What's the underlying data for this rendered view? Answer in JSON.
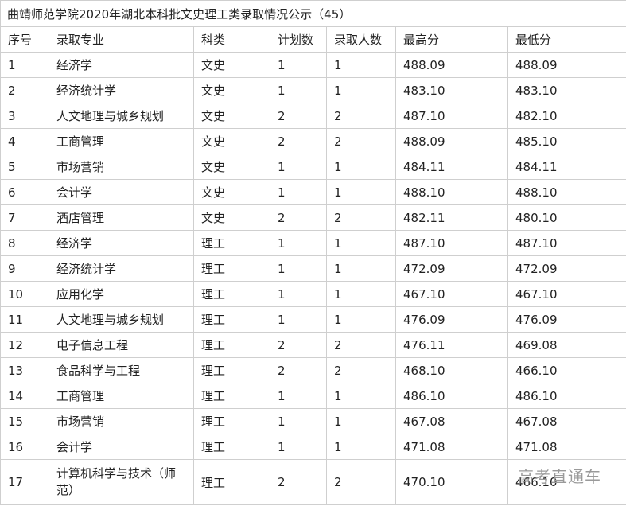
{
  "title": "曲靖师范学院2020年湖北本科批文史理工类录取情况公示（45）",
  "headers": [
    "序号",
    "录取专业",
    "科类",
    "计划数",
    "录取人数",
    "最高分",
    "最低分"
  ],
  "rows": [
    [
      "1",
      "经济学",
      "文史",
      "1",
      "1",
      "488.09",
      "488.09"
    ],
    [
      "2",
      "经济统计学",
      "文史",
      "1",
      "1",
      "483.10",
      "483.10"
    ],
    [
      "3",
      "人文地理与城乡规划",
      "文史",
      "2",
      "2",
      "487.10",
      "482.10"
    ],
    [
      "4",
      "工商管理",
      "文史",
      "2",
      "2",
      "488.09",
      "485.10"
    ],
    [
      "5",
      "市场营销",
      "文史",
      "1",
      "1",
      "484.11",
      "484.11"
    ],
    [
      "6",
      "会计学",
      "文史",
      "1",
      "1",
      "488.10",
      "488.10"
    ],
    [
      "7",
      "酒店管理",
      "文史",
      "2",
      "2",
      "482.11",
      "480.10"
    ],
    [
      "8",
      "经济学",
      "理工",
      "1",
      "1",
      "487.10",
      "487.10"
    ],
    [
      "9",
      "经济统计学",
      "理工",
      "1",
      "1",
      "472.09",
      "472.09"
    ],
    [
      "10",
      "应用化学",
      "理工",
      "1",
      "1",
      "467.10",
      "467.10"
    ],
    [
      "11",
      "人文地理与城乡规划",
      "理工",
      "1",
      "1",
      "476.09",
      "476.09"
    ],
    [
      "12",
      "电子信息工程",
      "理工",
      "2",
      "2",
      "476.11",
      "469.08"
    ],
    [
      "13",
      "食品科学与工程",
      "理工",
      "2",
      "2",
      "468.10",
      "466.10"
    ],
    [
      "14",
      "工商管理",
      "理工",
      "1",
      "1",
      "486.10",
      "486.10"
    ],
    [
      "15",
      "市场营销",
      "理工",
      "1",
      "1",
      "467.08",
      "467.08"
    ],
    [
      "16",
      "会计学",
      "理工",
      "1",
      "1",
      "471.08",
      "471.08"
    ],
    [
      "17",
      "计算机科学与技术（师范）",
      "理工",
      "2",
      "2",
      "470.10",
      "466.10"
    ]
  ],
  "watermark": "高考直通车"
}
